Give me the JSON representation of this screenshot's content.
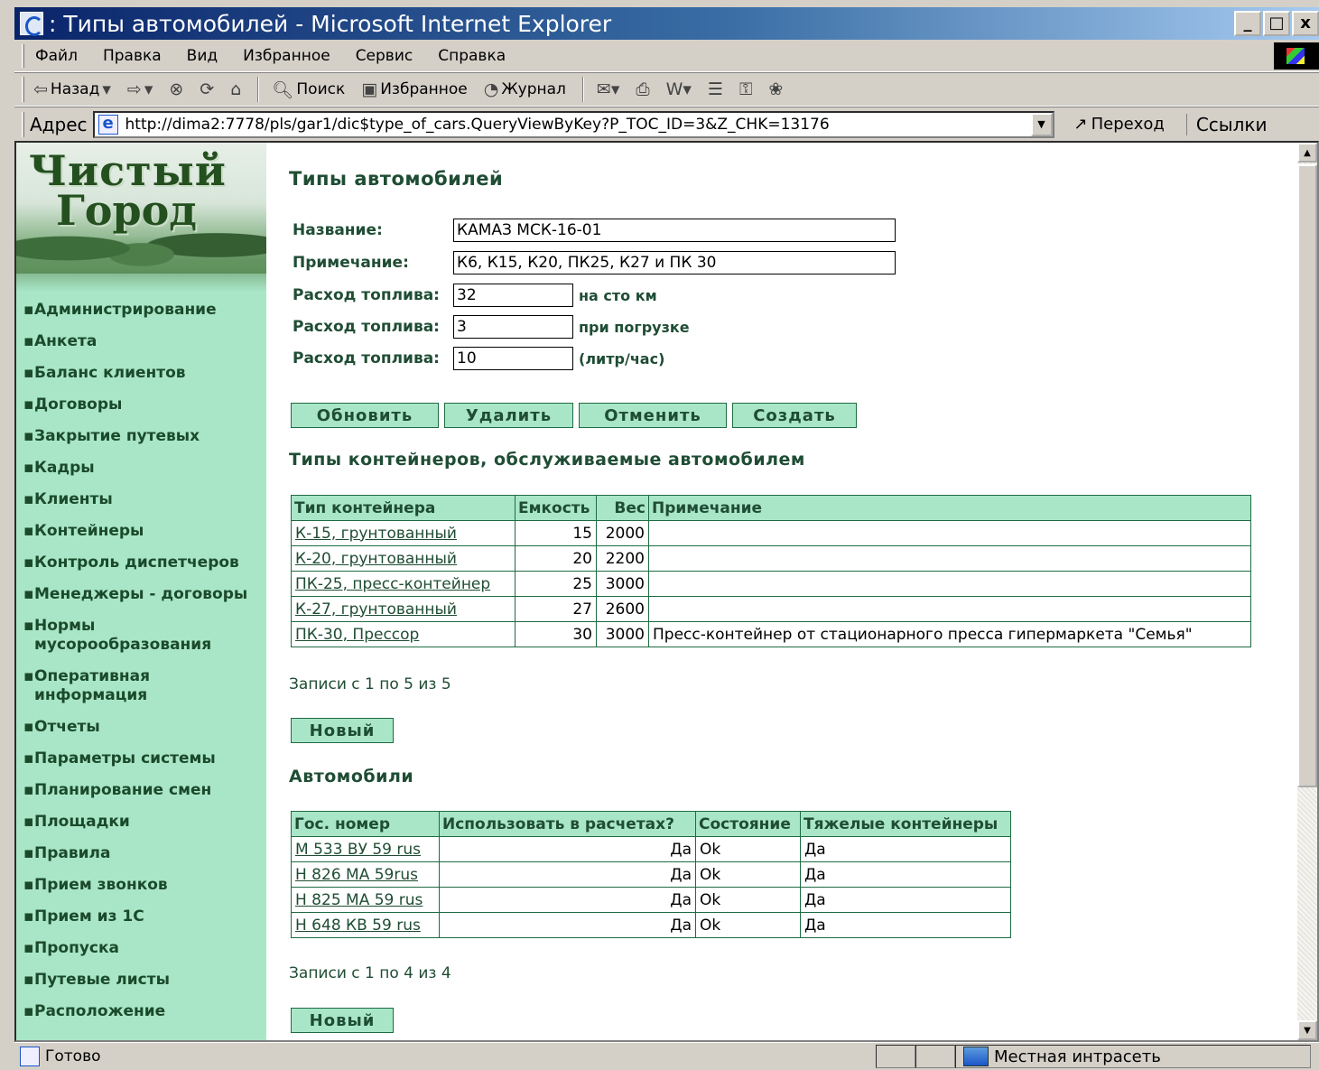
{
  "window": {
    "title": ": Типы автомобилей - Microsoft Internet Explorer",
    "btn_min": "_",
    "btn_max": "□",
    "btn_close": "x"
  },
  "menu": [
    "Файл",
    "Правка",
    "Вид",
    "Избранное",
    "Сервис",
    "Справка"
  ],
  "toolbar": {
    "back": "Назад",
    "search": "Поиск",
    "favorites": "Избранное",
    "history": "Журнал"
  },
  "address": {
    "label": "Адрес",
    "url": "http://dima2:7778/pls/gar1/dic$type_of_cars.QueryViewByKey?P_TOC_ID=3&Z_CHK=13176",
    "go": "Переход",
    "links": "Ссылки"
  },
  "logo": {
    "line1": "Чистый",
    "line2": "Город"
  },
  "nav": [
    "Администрирование",
    "Анкета",
    "Баланс клиентов",
    "Договоры",
    "Закрытие путевых",
    "Кадры",
    "Клиенты",
    "Контейнеры",
    "Контроль диспетчеров",
    "Менеджеры - договоры",
    "Нормы мусорообразования",
    "Оперативная информация",
    "Отчеты",
    "Параметры системы",
    "Планирование смен",
    "Площадки",
    "Правила",
    "Прием звонков",
    "Прием из 1С",
    "Пропуска",
    "Путевые листы",
    "Расположение"
  ],
  "page": {
    "title": "Типы автомобилей"
  },
  "form": {
    "name_label": "Название:",
    "name_value": "КАМАЗ МСК-16-01",
    "note_label": "Примечание:",
    "note_value": "К6, К15, К20, ПК25, К27 и ПК 30",
    "fuel1_label": "Расход топлива:",
    "fuel1_value": "32",
    "fuel1_unit": "на сто км",
    "fuel2_label": "Расход топлива:",
    "fuel2_value": "3",
    "fuel2_unit": "при погрузке",
    "fuel3_label": "Расход топлива:",
    "fuel3_value": "10",
    "fuel3_unit": "(литр/час)"
  },
  "actions": {
    "update": "Обновить",
    "delete": "Удалить",
    "cancel": "Отменить",
    "create": "Создать"
  },
  "containers": {
    "title": "Типы контейнеров, обслуживаемые автомобилем",
    "headers": [
      "Тип контейнера",
      "Емкость",
      "Вес",
      "Примечание"
    ],
    "rows": [
      [
        "К-15, грунтованный",
        "15",
        "2000",
        ""
      ],
      [
        "К-20, грунтованный",
        "20",
        "2200",
        ""
      ],
      [
        "ПК-25, пресс-контейнер",
        "25",
        "3000",
        ""
      ],
      [
        "К-27, грунтованный",
        "27",
        "2600",
        ""
      ],
      [
        "ПК-30, Прессор",
        "30",
        "3000",
        "Пресс-контейнер от стационарного пресса гипермаркета \"Семья\""
      ]
    ],
    "records": "Записи с 1 по 5 из 5",
    "new_button": "Новый"
  },
  "cars": {
    "title": "Автомобили",
    "headers": [
      "Гос. номер",
      "Использовать в расчетах?",
      "Состояние",
      "Тяжелые контейнеры"
    ],
    "rows": [
      [
        "М 533 ВУ 59 rus",
        "Да",
        "Ok",
        "Да"
      ],
      [
        "Н 826 МА 59rus",
        "Да",
        "Ok",
        "Да"
      ],
      [
        "Н 825 МА 59 rus",
        "Да",
        "Ok",
        "Да"
      ],
      [
        "Н 648 КВ 59 rus",
        "Да",
        "Ok",
        "Да"
      ]
    ],
    "records": "Записи с 1 по 4 из 4",
    "new_button": "Новый"
  },
  "status": {
    "text": "Готово",
    "zone": "Местная интрасеть"
  }
}
